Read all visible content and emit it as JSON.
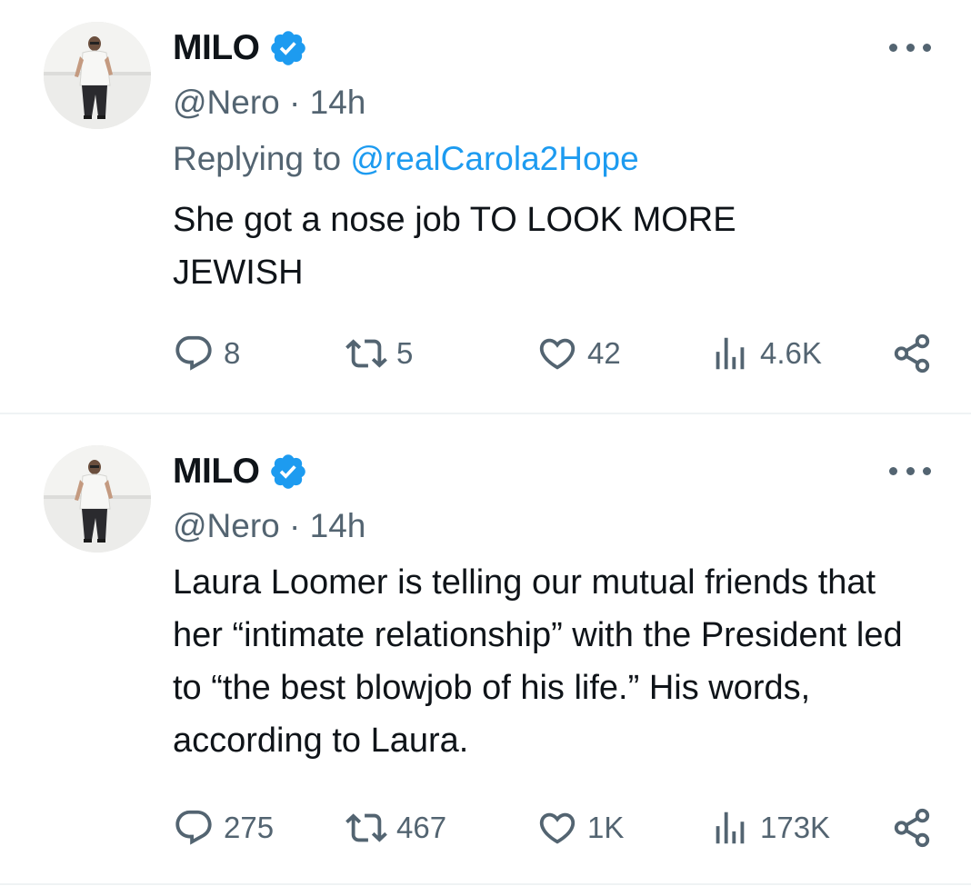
{
  "tweets": [
    {
      "name": "MILO",
      "handle": "@Nero",
      "separator": "·",
      "time": "14h",
      "reply_prefix": "Replying to",
      "reply_to": "@realCarola2Hope",
      "text": "She got a nose job TO LOOK MORE JEWISH",
      "replies": "8",
      "retweets": "5",
      "likes": "42",
      "views": "4.6K"
    },
    {
      "name": "MILO",
      "handle": "@Nero",
      "separator": "·",
      "time": "14h",
      "text": "Laura Loomer is telling our mutual friends that her “intimate relationship” with the President led to “the best blowjob of his life.” His words, according to Laura.",
      "replies": "275",
      "retweets": "467",
      "likes": "1K",
      "views": "173K"
    }
  ],
  "icons": {
    "verified": "verified-badge-icon",
    "more": "more-options-icon",
    "reply": "reply-icon",
    "retweet": "retweet-icon",
    "like": "heart-icon",
    "views": "views-icon",
    "share": "share-icon"
  },
  "colors": {
    "verified_blue": "#1d9bf0",
    "mention_blue": "#1d9bf0",
    "secondary_text": "#536471",
    "primary_text": "#0f1419",
    "divider": "#eff3f4"
  }
}
